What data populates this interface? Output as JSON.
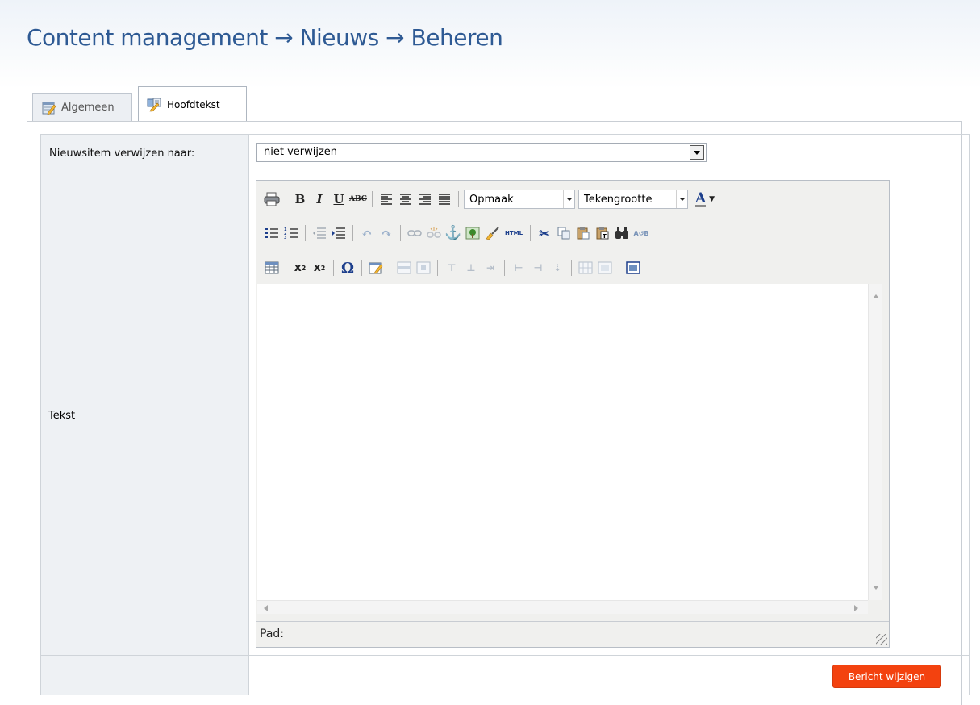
{
  "header": {
    "title": "Content management → Nieuws → Beheren"
  },
  "tabs": [
    {
      "label": "Algemeen",
      "active": false,
      "icon": "edit-note-icon"
    },
    {
      "label": "Hoofdtekst",
      "active": true,
      "icon": "edit-doc-icon"
    }
  ],
  "form": {
    "redirect_label": "Nieuwsitem verwijzen naar:",
    "redirect_value": "niet verwijzen",
    "text_label": "Tekst"
  },
  "editor": {
    "format_select": "Opmaak",
    "fontsize_select": "Tekengrootte",
    "html_button": "HTML",
    "path_label": "Pad:"
  },
  "actions": {
    "submit_label": "Bericht wijzigen"
  },
  "colors": {
    "title": "#2e5a94",
    "submit": "#f3420f"
  }
}
